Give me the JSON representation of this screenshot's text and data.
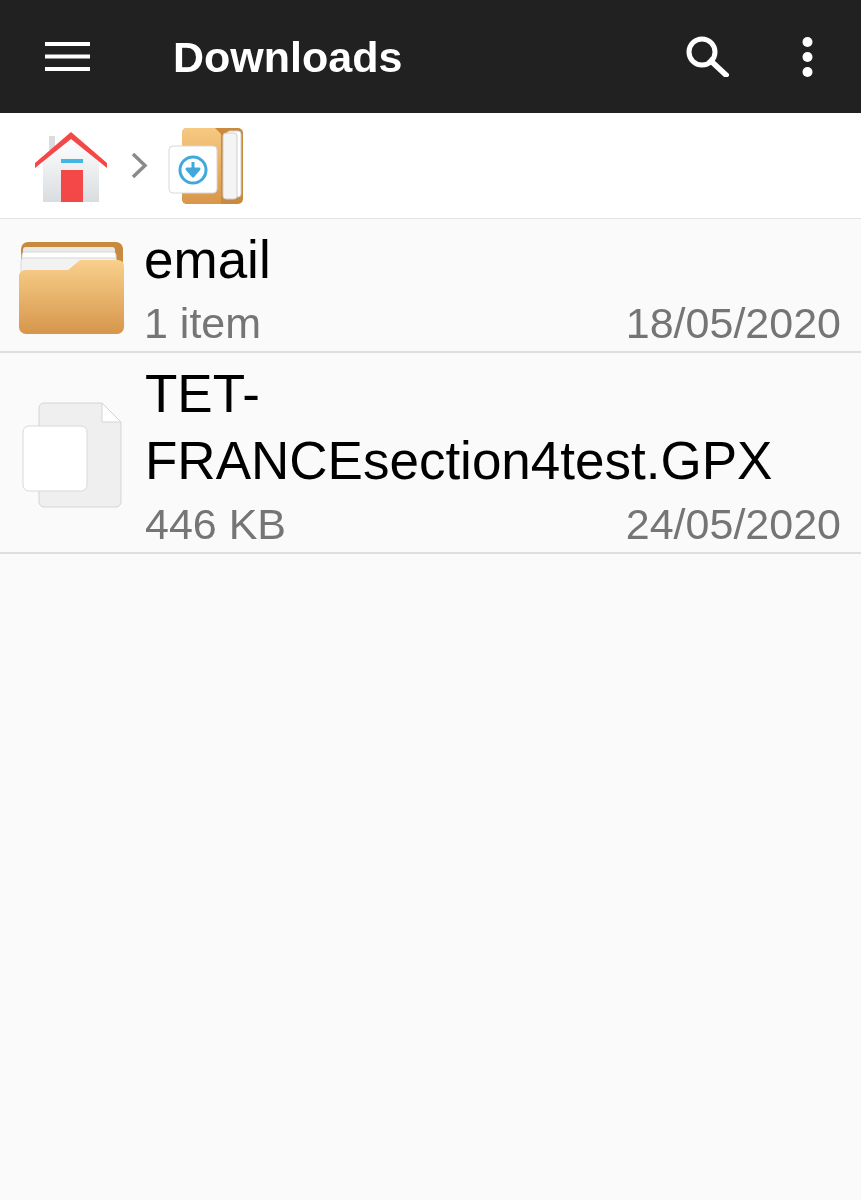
{
  "app_bar": {
    "title": "Downloads"
  },
  "breadcrumb": [
    {
      "kind": "home"
    },
    {
      "kind": "downloads_folder"
    }
  ],
  "files": [
    {
      "kind": "folder",
      "name": "email",
      "detail": "1 item",
      "date": "18/05/2020"
    },
    {
      "kind": "file",
      "name": "TET-FRANCEsection4test.GPX",
      "detail": "446 KB",
      "date": "24/05/2020"
    }
  ]
}
